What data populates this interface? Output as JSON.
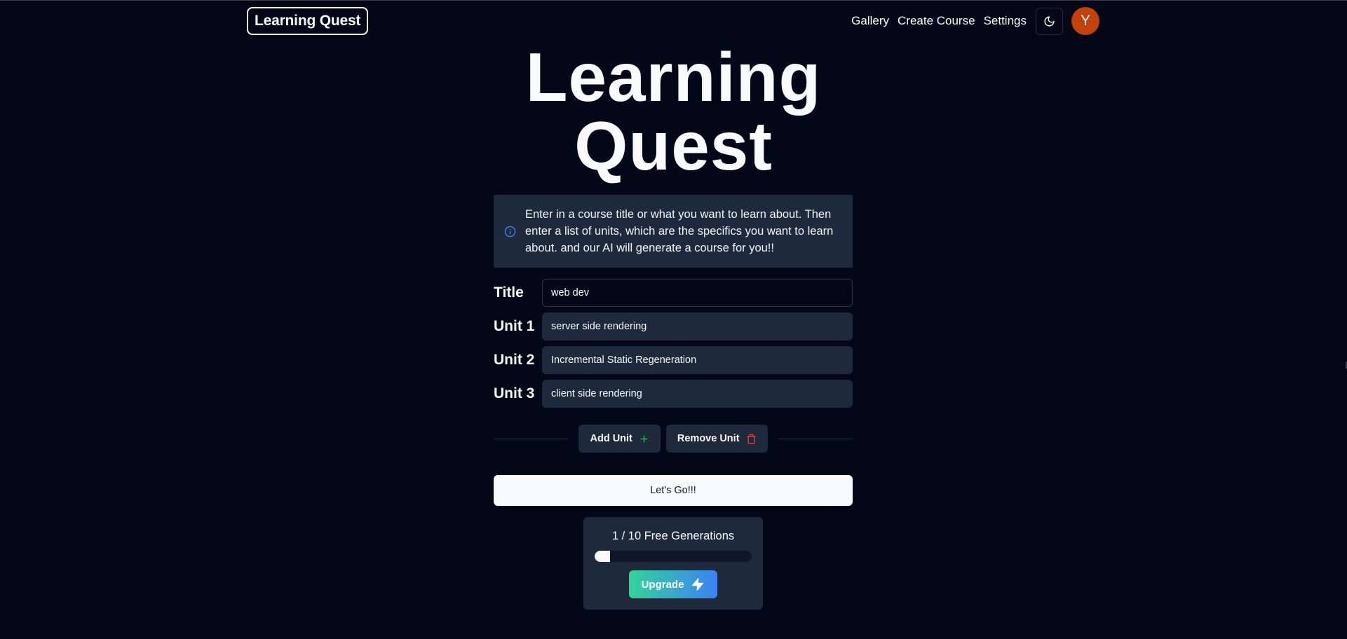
{
  "nav": {
    "brand": "Learning Quest",
    "links": [
      "Gallery",
      "Create Course",
      "Settings"
    ],
    "theme_icon": "moon-icon",
    "avatar_initial": "Y",
    "avatar_color": "#c2410c"
  },
  "hero": {
    "line1": "Learning",
    "line2": "Quest"
  },
  "alert": {
    "icon": "info-icon",
    "text": "Enter in a course title or what you want to learn about. Then enter a list of units, which are the specifics you want to learn about. and our AI will generate a course for you!!"
  },
  "form": {
    "title_label": "Title",
    "title_value": "web dev",
    "units": [
      {
        "label": "Unit 1",
        "value": "server side rendering"
      },
      {
        "label": "Unit 2",
        "value": "Incremental Static Regeneration"
      },
      {
        "label": "Unit 3",
        "value": "client side rendering"
      }
    ],
    "add_unit_label": "Add Unit",
    "add_unit_icon": "plus-icon",
    "add_unit_icon_color": "#22c55e",
    "remove_unit_label": "Remove Unit",
    "remove_unit_icon": "trash-icon",
    "remove_unit_icon_color": "#ef4444",
    "submit_label": "Let's Go!!!"
  },
  "generations": {
    "text": "1 / 10 Free Generations",
    "progress_fraction": 0.1,
    "upgrade_label": "Upgrade",
    "upgrade_icon": "zap-icon"
  }
}
